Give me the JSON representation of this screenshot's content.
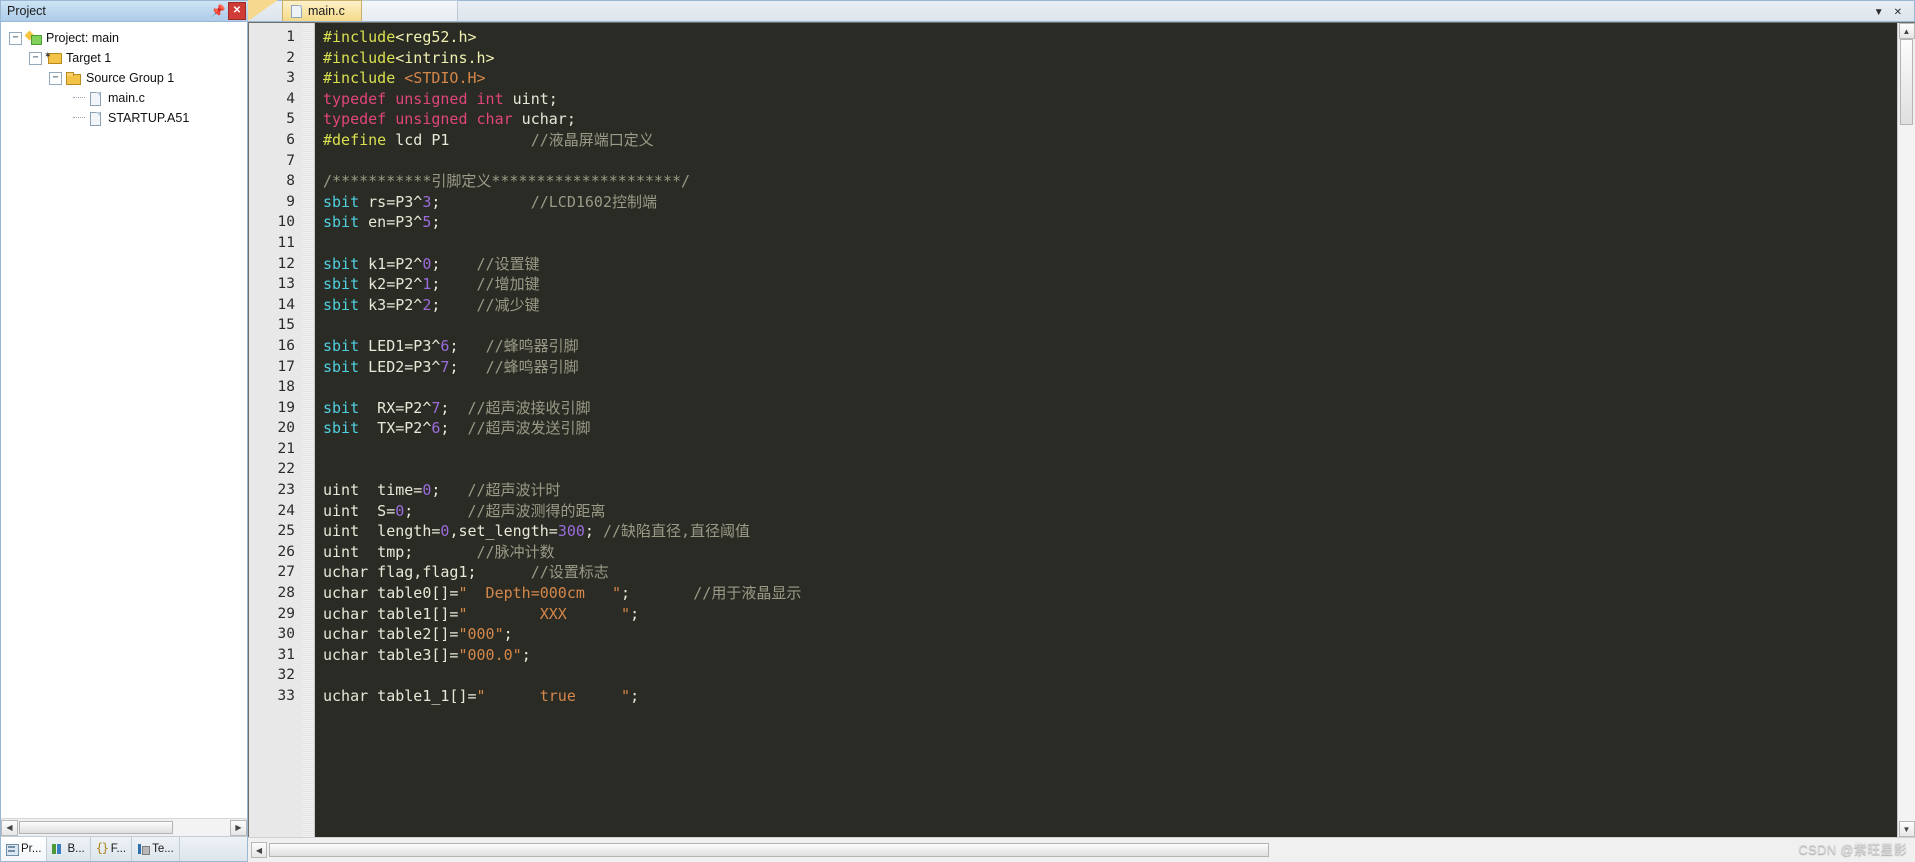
{
  "project_panel": {
    "title": "Project",
    "pin_icon": "pin-icon",
    "close_icon": "close-icon",
    "tree": [
      {
        "label": "Project: main",
        "depth": 0,
        "icon": "project-icon",
        "expander": "-"
      },
      {
        "label": "Target 1",
        "depth": 1,
        "icon": "target-icon",
        "expander": "-"
      },
      {
        "label": "Source Group 1",
        "depth": 2,
        "icon": "folder-icon",
        "expander": "-"
      },
      {
        "label": "main.c",
        "depth": 3,
        "icon": "file-icon",
        "expander": ""
      },
      {
        "label": "STARTUP.A51",
        "depth": 3,
        "icon": "file-icon",
        "expander": ""
      }
    ],
    "bottom_tabs": [
      {
        "label": "Pr...",
        "icon": "project-window-icon",
        "active": true
      },
      {
        "label": "B...",
        "icon": "books-icon",
        "active": false
      },
      {
        "label": "F...",
        "icon": "functions-icon",
        "active": false
      },
      {
        "label": "Te...",
        "icon": "templates-icon",
        "active": false
      }
    ]
  },
  "tabs": {
    "items": [
      {
        "label": "main.c",
        "icon": "document-icon",
        "active": true
      }
    ],
    "left_arrow_icon": "chevron-down-icon",
    "right_arrow_icon": "close-icon"
  },
  "editor": {
    "first_line": 1,
    "last_line": 33,
    "lines": [
      {
        "n": 1,
        "tokens": [
          {
            "t": "#include",
            "c": "pre"
          },
          {
            "t": "<reg52.h>",
            "c": "hdr"
          }
        ]
      },
      {
        "n": 2,
        "tokens": [
          {
            "t": "#include",
            "c": "pre"
          },
          {
            "t": "<intrins.h>",
            "c": "hdr"
          }
        ]
      },
      {
        "n": 3,
        "tokens": [
          {
            "t": "#include",
            "c": "pre"
          },
          {
            "t": " ",
            "c": "plain"
          },
          {
            "t": "<STDIO.H>",
            "c": "hdr2"
          }
        ]
      },
      {
        "n": 4,
        "tokens": [
          {
            "t": "typedef unsigned int",
            "c": "type"
          },
          {
            "t": " uint;",
            "c": "plain"
          }
        ]
      },
      {
        "n": 5,
        "tokens": [
          {
            "t": "typedef unsigned char",
            "c": "type"
          },
          {
            "t": " uchar;",
            "c": "plain"
          }
        ]
      },
      {
        "n": 6,
        "tokens": [
          {
            "t": "#define",
            "c": "pre"
          },
          {
            "t": " lcd P1         ",
            "c": "plain"
          },
          {
            "t": "//液晶屏端口定义",
            "c": "cmt"
          }
        ]
      },
      {
        "n": 7,
        "tokens": []
      },
      {
        "n": 8,
        "tokens": [
          {
            "t": "/***********引脚定义*********************/",
            "c": "cmt"
          }
        ]
      },
      {
        "n": 9,
        "tokens": [
          {
            "t": "sbit",
            "c": "sbit"
          },
          {
            "t": " rs=P3^",
            "c": "plain"
          },
          {
            "t": "3",
            "c": "num"
          },
          {
            "t": ";          ",
            "c": "plain"
          },
          {
            "t": "//LCD1602控制端",
            "c": "cmt"
          }
        ]
      },
      {
        "n": 10,
        "tokens": [
          {
            "t": "sbit",
            "c": "sbit"
          },
          {
            "t": " en=P3^",
            "c": "plain"
          },
          {
            "t": "5",
            "c": "num"
          },
          {
            "t": ";",
            "c": "plain"
          }
        ]
      },
      {
        "n": 11,
        "tokens": []
      },
      {
        "n": 12,
        "tokens": [
          {
            "t": "sbit",
            "c": "sbit"
          },
          {
            "t": " k1=P2^",
            "c": "plain"
          },
          {
            "t": "0",
            "c": "num"
          },
          {
            "t": ";    ",
            "c": "plain"
          },
          {
            "t": "//设置键",
            "c": "cmt"
          }
        ]
      },
      {
        "n": 13,
        "tokens": [
          {
            "t": "sbit",
            "c": "sbit"
          },
          {
            "t": " k2=P2^",
            "c": "plain"
          },
          {
            "t": "1",
            "c": "num"
          },
          {
            "t": ";    ",
            "c": "plain"
          },
          {
            "t": "//增加键",
            "c": "cmt"
          }
        ]
      },
      {
        "n": 14,
        "tokens": [
          {
            "t": "sbit",
            "c": "sbit"
          },
          {
            "t": " k3=P2^",
            "c": "plain"
          },
          {
            "t": "2",
            "c": "num"
          },
          {
            "t": ";    ",
            "c": "plain"
          },
          {
            "t": "//减少键",
            "c": "cmt"
          }
        ]
      },
      {
        "n": 15,
        "tokens": []
      },
      {
        "n": 16,
        "tokens": [
          {
            "t": "sbit",
            "c": "sbit"
          },
          {
            "t": " LED1=P3^",
            "c": "plain"
          },
          {
            "t": "6",
            "c": "num"
          },
          {
            "t": ";   ",
            "c": "plain"
          },
          {
            "t": "//蜂鸣器引脚",
            "c": "cmt"
          }
        ]
      },
      {
        "n": 17,
        "tokens": [
          {
            "t": "sbit",
            "c": "sbit"
          },
          {
            "t": " LED2=P3^",
            "c": "plain"
          },
          {
            "t": "7",
            "c": "num"
          },
          {
            "t": ";   ",
            "c": "plain"
          },
          {
            "t": "//蜂鸣器引脚",
            "c": "cmt"
          }
        ]
      },
      {
        "n": 18,
        "tokens": []
      },
      {
        "n": 19,
        "tokens": [
          {
            "t": "sbit",
            "c": "sbit"
          },
          {
            "t": "  RX=P2^",
            "c": "plain"
          },
          {
            "t": "7",
            "c": "num"
          },
          {
            "t": ";  ",
            "c": "plain"
          },
          {
            "t": "//超声波接收引脚",
            "c": "cmt"
          }
        ]
      },
      {
        "n": 20,
        "tokens": [
          {
            "t": "sbit",
            "c": "sbit"
          },
          {
            "t": "  TX=P2^",
            "c": "plain"
          },
          {
            "t": "6",
            "c": "num"
          },
          {
            "t": ";  ",
            "c": "plain"
          },
          {
            "t": "//超声波发送引脚",
            "c": "cmt"
          }
        ]
      },
      {
        "n": 21,
        "tokens": []
      },
      {
        "n": 22,
        "tokens": []
      },
      {
        "n": 23,
        "tokens": [
          {
            "t": "uint  time=",
            "c": "plain"
          },
          {
            "t": "0",
            "c": "num"
          },
          {
            "t": ";   ",
            "c": "plain"
          },
          {
            "t": "//超声波计时",
            "c": "cmt"
          }
        ]
      },
      {
        "n": 24,
        "tokens": [
          {
            "t": "uint  S=",
            "c": "plain"
          },
          {
            "t": "0",
            "c": "num"
          },
          {
            "t": ";      ",
            "c": "plain"
          },
          {
            "t": "//超声波测得的距离",
            "c": "cmt"
          }
        ]
      },
      {
        "n": 25,
        "tokens": [
          {
            "t": "uint  length=",
            "c": "plain"
          },
          {
            "t": "0",
            "c": "num"
          },
          {
            "t": ",set_length=",
            "c": "plain"
          },
          {
            "t": "300",
            "c": "num"
          },
          {
            "t": "; ",
            "c": "plain"
          },
          {
            "t": "//缺陷直径,直径阈值",
            "c": "cmt"
          }
        ]
      },
      {
        "n": 26,
        "tokens": [
          {
            "t": "uint  tmp;       ",
            "c": "plain"
          },
          {
            "t": "//脉冲计数",
            "c": "cmt"
          }
        ]
      },
      {
        "n": 27,
        "tokens": [
          {
            "t": "uchar flag,flag1;      ",
            "c": "plain"
          },
          {
            "t": "//设置标志",
            "c": "cmt"
          }
        ]
      },
      {
        "n": 28,
        "tokens": [
          {
            "t": "uchar table0[]=",
            "c": "plain"
          },
          {
            "t": "\"  Depth=000cm   \"",
            "c": "str"
          },
          {
            "t": ";       ",
            "c": "plain"
          },
          {
            "t": "//用于液晶显示",
            "c": "cmt"
          }
        ]
      },
      {
        "n": 29,
        "tokens": [
          {
            "t": "uchar table1[]=",
            "c": "plain"
          },
          {
            "t": "\"        XXX      \"",
            "c": "str"
          },
          {
            "t": ";",
            "c": "plain"
          }
        ]
      },
      {
        "n": 30,
        "tokens": [
          {
            "t": "uchar table2[]=",
            "c": "plain"
          },
          {
            "t": "\"000\"",
            "c": "str"
          },
          {
            "t": ";",
            "c": "plain"
          }
        ]
      },
      {
        "n": 31,
        "tokens": [
          {
            "t": "uchar table3[]=",
            "c": "plain"
          },
          {
            "t": "\"000.0\"",
            "c": "str"
          },
          {
            "t": ";",
            "c": "plain"
          }
        ]
      },
      {
        "n": 32,
        "tokens": []
      },
      {
        "n": 33,
        "tokens": [
          {
            "t": "uchar table1_1[]=",
            "c": "plain"
          },
          {
            "t": "\"      true     \"",
            "c": "str"
          },
          {
            "t": ";",
            "c": "plain"
          }
        ]
      }
    ]
  },
  "watermark": {
    "text": "CSDN @紫旺星影"
  }
}
